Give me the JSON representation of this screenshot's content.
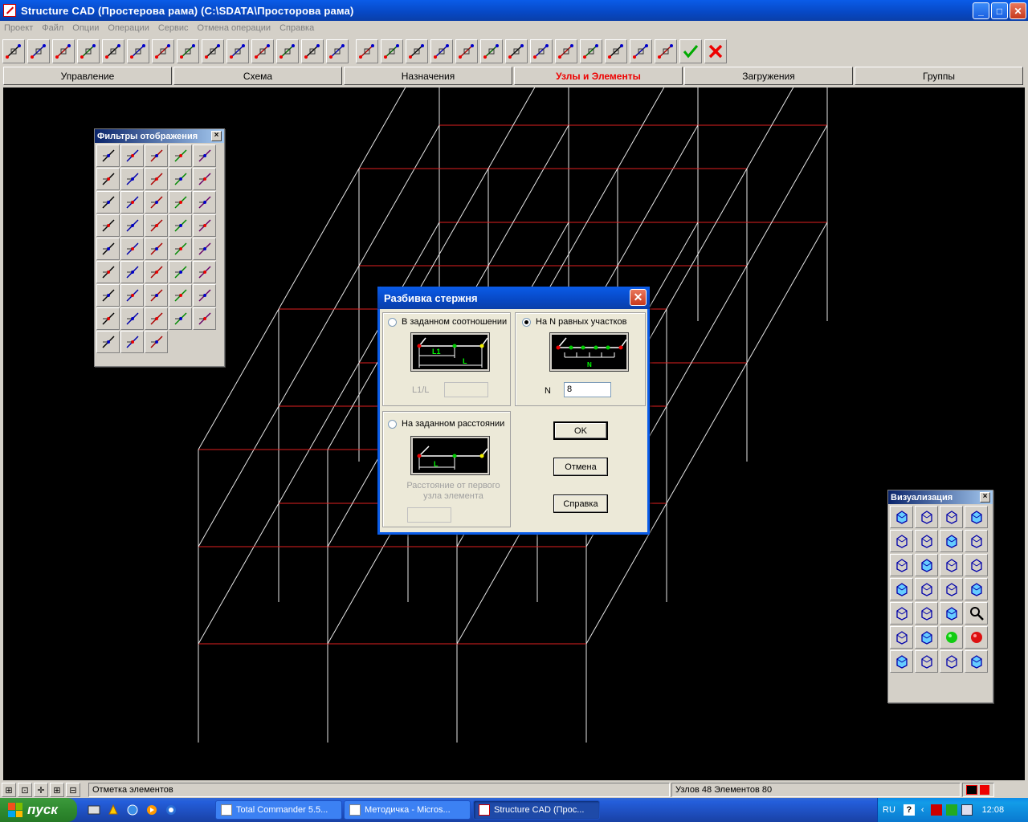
{
  "window": {
    "title": "Structure CAD (Простерова рама) (C:\\SDATA\\Просторова рама)",
    "minimize": "_",
    "maximize": "□",
    "close": "✕"
  },
  "menu": [
    "Проект",
    "Файл",
    "Опции",
    "Операции",
    "Сервис",
    "Отмена операции",
    "Справка"
  ],
  "tabs": [
    {
      "label": "Управление",
      "active": false
    },
    {
      "label": "Схема",
      "active": false
    },
    {
      "label": "Назначения",
      "active": false
    },
    {
      "label": "Узлы и Элементы",
      "active": true
    },
    {
      "label": "Загружения",
      "active": false
    },
    {
      "label": "Группы",
      "active": false
    }
  ],
  "filters_palette": {
    "title": "Фильтры отображения",
    "close": "×"
  },
  "viz_palette": {
    "title": "Визуализация",
    "close": "×"
  },
  "dialog": {
    "title": "Разбивка стержня",
    "close": "✕",
    "option_ratio": {
      "label": "В заданном соотношении",
      "selected": false,
      "pic_l1": "L1",
      "pic_l": "L",
      "field_label": "L1/L",
      "value": ""
    },
    "option_equal": {
      "label": "На  N равных участков",
      "selected": true,
      "pic_n": "N",
      "field_label": "N",
      "value": "8"
    },
    "option_distance": {
      "label": "На заданном расстоянии",
      "selected": false,
      "pic_l": "L",
      "note": "Расстояние от первого узла элемента",
      "value": ""
    },
    "ok": "OK",
    "cancel": "Отмена",
    "help": "Справка"
  },
  "status": {
    "mode": "Отметка элементов",
    "counts": "Узлов 48 Элементов 80"
  },
  "taskbar": {
    "start": "пуск",
    "tasks": [
      {
        "label": "Total Commander 5.5...",
        "active": false
      },
      {
        "label": "Методичка - Micros...",
        "active": false
      },
      {
        "label": "Structure CAD (Прос...",
        "active": true
      }
    ],
    "lang": "RU",
    "clock": "12:08"
  },
  "colors": {
    "frame_beam": "#e02020",
    "frame_column": "#e8e8e8",
    "title_blue": "#0a5ce8"
  }
}
